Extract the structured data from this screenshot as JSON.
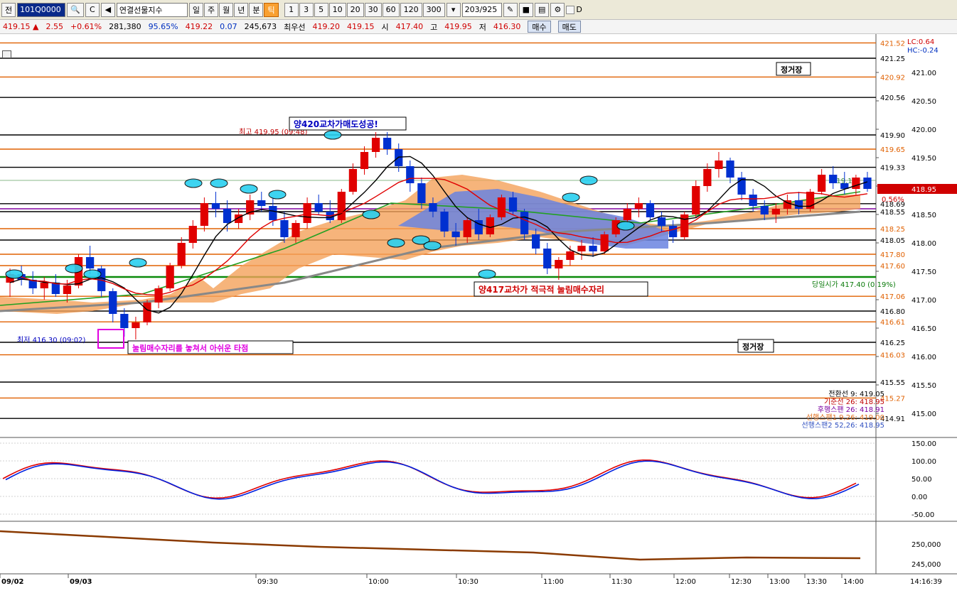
{
  "toolbar": {
    "b1": "전",
    "code": "101Q0000",
    "search": "🔍",
    "b2": "C",
    "product": "연결선물지수",
    "periods": [
      "일",
      "주",
      "월",
      "년",
      "분",
      "틱"
    ],
    "active_period": "틱",
    "ticks": [
      "1",
      "3",
      "5",
      "10",
      "20",
      "30",
      "60",
      "120",
      "300"
    ],
    "count": "203/925",
    "opt": "D"
  },
  "quote": {
    "price": "419.15 ▲",
    "change": "2.55",
    "pct": "+0.61%",
    "volume": "281,380",
    "ratio": "95.65%",
    "v2": "419.22",
    "v3": "0.07",
    "oi": "245,673",
    "best_label": "최우선",
    "best_ask": "419.20",
    "best_bid": "419.15",
    "open_label": "시",
    "open": "417.40",
    "high_label": "고",
    "high": "419.95",
    "low_label": "저",
    "low": "416.30",
    "buy": "매수",
    "sell": "매도"
  },
  "axis": {
    "ticks": [
      "421.00",
      "420.50",
      "420.00",
      "419.50",
      "419.00",
      "418.50",
      "418.00",
      "417.50",
      "417.00",
      "416.50",
      "416.00",
      "415.50",
      "415.00"
    ],
    "lc": "LC:0.64",
    "hc": "HC:-0.24",
    "osc_ticks": [
      "150.00",
      "100.00",
      "50.00",
      "0.00",
      "-50.00"
    ],
    "vol_ticks": [
      "250,000",
      "245,000"
    ],
    "time": "14:16:39"
  },
  "price_lines": [
    {
      "label": "421.52",
      "color": "#e06000"
    },
    {
      "label": "421.25",
      "color": "#000000"
    },
    {
      "label": "420.92",
      "color": "#e06000"
    },
    {
      "label": "420.56",
      "color": "#000000"
    },
    {
      "label": "419.90",
      "color": "#000000"
    },
    {
      "label": "419.65",
      "color": "#e06000"
    },
    {
      "label": "419.33",
      "color": "#000000"
    },
    {
      "label": "418.69",
      "color": "#000000"
    },
    {
      "label": "418.55",
      "color": "#000000"
    },
    {
      "label": "418.25",
      "color": "#e06000"
    },
    {
      "label": "418.05",
      "color": "#000000"
    },
    {
      "label": "417.80",
      "color": "#e06000"
    },
    {
      "label": "417.60",
      "color": "#e06000"
    },
    {
      "label": "417.06",
      "color": "#e06000"
    },
    {
      "label": "416.80",
      "color": "#000000"
    },
    {
      "label": "416.61",
      "color": "#e06000"
    },
    {
      "label": "416.25",
      "color": "#000000"
    },
    {
      "label": "416.03",
      "color": "#e06000"
    },
    {
      "label": "415.55",
      "color": "#000000"
    },
    {
      "label": "415.27",
      "color": "#e06000"
    },
    {
      "label": "414.91",
      "color": "#000000"
    }
  ],
  "current_price": "418.95",
  "current_pct": "0.56%",
  "line_419_10": "419.10",
  "open_line_label": "당일시가 417.40 (0.19%)",
  "annotations": {
    "high": "최고 419.95 (09:48)",
    "low": "최저 416.30 (09:02)",
    "success": "양420교차가매도성공!",
    "buy_zone": "양417교차가 적극적 눌림매수자리",
    "missed": "눌림매수자리를 놓쳐서 아쉬운 타점",
    "noon1": "정거장",
    "noon2": "정거장"
  },
  "legend": [
    {
      "text": "전환선 9: 419.05",
      "color": "#000000"
    },
    {
      "text": "기준선 26: 418.95",
      "color": "#c00000"
    },
    {
      "text": "후행스팬 26: 418.91",
      "color": "#7a00a0"
    },
    {
      "text": "선행스팬1 9,26: 419.00",
      "color": "#e07020"
    },
    {
      "text": "선행스팬2 52,26: 418.95",
      "color": "#3050c0"
    }
  ],
  "time_labels": [
    "09/02",
    "09/03",
    "09:30",
    "10:00",
    "10:30",
    "11:00",
    "11:30",
    "12:00",
    "12:30",
    "13:00",
    "13:30",
    "14:00"
  ],
  "chart_data": {
    "type": "candlestick",
    "y_range": [
      414.6,
      421.6
    ],
    "ohlc": [
      [
        417.3,
        417.55,
        417.05,
        417.45
      ],
      [
        417.45,
        417.6,
        417.25,
        417.35
      ],
      [
        417.35,
        417.5,
        417.1,
        417.2
      ],
      [
        417.2,
        417.4,
        417.0,
        417.3
      ],
      [
        417.3,
        417.45,
        417.05,
        417.1
      ],
      [
        417.1,
        417.35,
        416.95,
        417.25
      ],
      [
        417.25,
        417.8,
        417.2,
        417.75
      ],
      [
        417.75,
        417.95,
        417.45,
        417.55
      ],
      [
        417.55,
        417.6,
        417.05,
        417.15
      ],
      [
        417.15,
        417.2,
        416.6,
        416.75
      ],
      [
        416.75,
        416.85,
        416.35,
        416.5
      ],
      [
        416.5,
        416.7,
        416.3,
        416.6
      ],
      [
        416.6,
        417.0,
        416.55,
        416.95
      ],
      [
        416.95,
        417.25,
        416.85,
        417.2
      ],
      [
        417.2,
        417.65,
        417.15,
        417.6
      ],
      [
        417.6,
        418.1,
        417.55,
        418.0
      ],
      [
        418.0,
        418.4,
        417.9,
        418.3
      ],
      [
        418.3,
        418.8,
        418.2,
        418.7
      ],
      [
        418.7,
        418.9,
        418.45,
        418.6
      ],
      [
        418.6,
        418.75,
        418.2,
        418.35
      ],
      [
        418.35,
        418.6,
        418.25,
        418.5
      ],
      [
        418.5,
        418.85,
        418.4,
        418.75
      ],
      [
        418.75,
        418.9,
        418.55,
        418.65
      ],
      [
        418.65,
        418.8,
        418.3,
        418.4
      ],
      [
        418.4,
        418.55,
        418.0,
        418.1
      ],
      [
        418.1,
        418.4,
        418.0,
        418.35
      ],
      [
        418.35,
        418.8,
        418.25,
        418.7
      ],
      [
        418.7,
        418.85,
        418.5,
        418.55
      ],
      [
        418.55,
        418.75,
        418.35,
        418.4
      ],
      [
        418.4,
        418.95,
        418.35,
        418.9
      ],
      [
        418.9,
        419.4,
        418.85,
        419.3
      ],
      [
        419.3,
        419.7,
        419.2,
        419.6
      ],
      [
        419.6,
        419.95,
        419.5,
        419.85
      ],
      [
        419.85,
        419.95,
        419.55,
        419.65
      ],
      [
        419.65,
        419.75,
        419.25,
        419.35
      ],
      [
        419.35,
        419.45,
        418.9,
        419.05
      ],
      [
        419.05,
        419.15,
        418.6,
        418.7
      ],
      [
        418.7,
        418.8,
        418.45,
        418.55
      ],
      [
        418.55,
        418.6,
        418.1,
        418.2
      ],
      [
        418.2,
        418.35,
        417.95,
        418.1
      ],
      [
        418.1,
        418.45,
        418.0,
        418.4
      ],
      [
        418.4,
        418.6,
        418.05,
        418.15
      ],
      [
        418.15,
        418.5,
        418.1,
        418.45
      ],
      [
        418.45,
        418.85,
        418.4,
        418.8
      ],
      [
        418.8,
        418.9,
        418.5,
        418.55
      ],
      [
        418.55,
        418.6,
        418.05,
        418.15
      ],
      [
        418.15,
        418.25,
        417.8,
        417.9
      ],
      [
        417.9,
        418.0,
        417.45,
        417.55
      ],
      [
        417.55,
        417.75,
        417.35,
        417.7
      ],
      [
        417.7,
        417.95,
        417.6,
        417.85
      ],
      [
        417.85,
        418.05,
        417.7,
        417.95
      ],
      [
        417.95,
        418.1,
        417.75,
        417.85
      ],
      [
        417.85,
        418.2,
        417.8,
        418.15
      ],
      [
        418.15,
        418.45,
        418.1,
        418.4
      ],
      [
        418.4,
        418.7,
        418.35,
        418.6
      ],
      [
        418.6,
        418.8,
        418.45,
        418.7
      ],
      [
        418.7,
        418.75,
        418.4,
        418.45
      ],
      [
        418.45,
        418.55,
        418.2,
        418.3
      ],
      [
        418.3,
        418.4,
        418.0,
        418.1
      ],
      [
        418.1,
        418.55,
        418.05,
        418.5
      ],
      [
        418.5,
        419.1,
        418.45,
        419.0
      ],
      [
        419.0,
        419.4,
        418.9,
        419.3
      ],
      [
        419.3,
        419.6,
        419.15,
        419.45
      ],
      [
        419.45,
        419.5,
        419.05,
        419.15
      ],
      [
        419.15,
        419.25,
        418.75,
        418.85
      ],
      [
        418.85,
        418.95,
        418.55,
        418.65
      ],
      [
        418.65,
        418.75,
        418.4,
        418.5
      ],
      [
        418.5,
        418.7,
        418.35,
        418.6
      ],
      [
        418.6,
        418.85,
        418.5,
        418.75
      ],
      [
        418.75,
        418.9,
        418.5,
        418.6
      ],
      [
        418.6,
        418.95,
        418.55,
        418.9
      ],
      [
        418.9,
        419.3,
        418.85,
        419.2
      ],
      [
        419.2,
        419.35,
        418.95,
        419.05
      ],
      [
        419.05,
        419.25,
        418.85,
        418.95
      ],
      [
        418.95,
        419.2,
        418.85,
        419.15
      ],
      [
        419.15,
        419.25,
        418.9,
        418.95
      ]
    ]
  }
}
